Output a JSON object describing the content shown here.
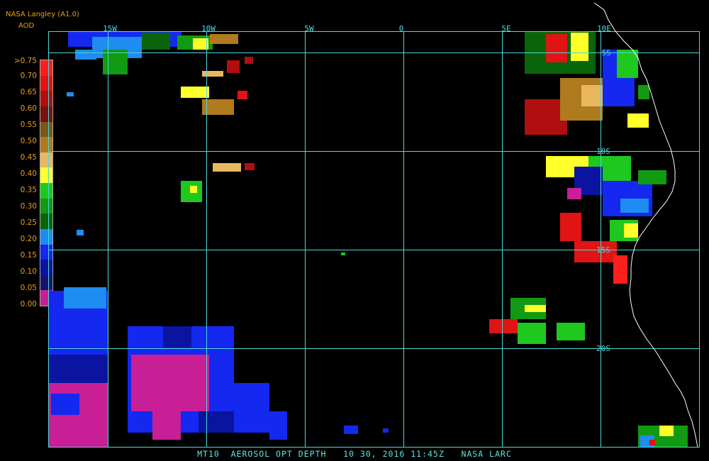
{
  "header": {
    "organization": "NASA Langley (A1.0)",
    "product": "AOD"
  },
  "legend": {
    "labels": [
      ">0.75",
      "0.70",
      "0.65",
      "0.60",
      "0.55",
      "0.50",
      "0.45",
      "0.40",
      "0.35",
      "0.30",
      "0.25",
      "0.20",
      "0.15",
      "0.10",
      "0.05",
      "0.00"
    ],
    "colors": [
      "#ff1e1e",
      "#e01414",
      "#b00f0f",
      "#7a1010",
      "#7a5818",
      "#b07a1e",
      "#e8b860",
      "#ffff2a",
      "#1ec81e",
      "#129a12",
      "#0a640a",
      "#1e8cf0",
      "#1428f0",
      "#0a14a0",
      "#14146e",
      "#c81e96"
    ]
  },
  "map": {
    "grid_color": "#4fd8d8",
    "coast_color": "#ffffff",
    "longitude_labels": [
      "15W",
      "10W",
      "5W",
      "0",
      "5E",
      "10E"
    ],
    "latitude_labels": [
      "5S",
      "10S",
      "15S",
      "20S"
    ]
  },
  "footer": {
    "text": "MT10  AEROSOL OPT DEPTH   10 30, 2016 11:45Z   NASA LARC"
  }
}
